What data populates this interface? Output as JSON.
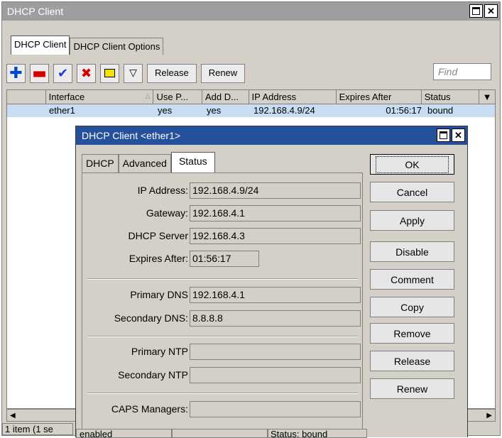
{
  "outer_window": {
    "title": "DHCP Client",
    "tabs": [
      "DHCP Client",
      "DHCP Client Options"
    ],
    "toolbar": {
      "release_label": "Release",
      "renew_label": "Renew",
      "find_placeholder": "Find",
      "filter_glyph": "▽"
    },
    "table": {
      "columns": [
        "Interface",
        "Use P...",
        "Add D...",
        "IP Address",
        "Expires After",
        "Status"
      ],
      "rows": [
        {
          "interface": "ether1",
          "use_peer": "yes",
          "add_default": "yes",
          "ip": "192.168.4.9/24",
          "expires": "01:56:17",
          "status": "bound"
        }
      ]
    },
    "statusbar": {
      "count": "1 item (1 se",
      "state": "enabled",
      "status": "Status: bound"
    }
  },
  "dialog": {
    "title": "DHCP Client <ether1>",
    "tabs": [
      "DHCP",
      "Advanced",
      "Status"
    ],
    "fields": {
      "ip_address": {
        "label": "IP Address:",
        "value": "192.168.4.9/24"
      },
      "gateway": {
        "label": "Gateway:",
        "value": "192.168.4.1"
      },
      "dhcp_server": {
        "label": "DHCP Server",
        "value": "192.168.4.3"
      },
      "expires_after": {
        "label": "Expires After:",
        "value": "01:56:17"
      },
      "primary_dns": {
        "label": "Primary DNS",
        "value": "192.168.4.1"
      },
      "secondary_dns": {
        "label": "Secondary DNS:",
        "value": "8.8.8.8"
      },
      "primary_ntp": {
        "label": "Primary NTP",
        "value": ""
      },
      "secondary_ntp": {
        "label": "Secondary NTP",
        "value": ""
      },
      "caps_managers": {
        "label": "CAPS Managers:",
        "value": ""
      }
    },
    "buttons": [
      "OK",
      "Cancel",
      "Apply",
      "Disable",
      "Comment",
      "Copy",
      "Remove",
      "Release",
      "Renew"
    ]
  },
  "icons": {
    "close_glyph": "✕",
    "plus_glyph": "✚",
    "minus_glyph": "▬",
    "check_glyph": "✔",
    "cross_glyph": "✖",
    "sort_glyph": "△",
    "dropdown_glyph": "▼",
    "left_glyph": "◀",
    "right_glyph": "▶"
  },
  "colors": {
    "active_title": "#24509c",
    "inactive_title": "#9e9e9e",
    "row_selected": "#c8dcf4"
  }
}
